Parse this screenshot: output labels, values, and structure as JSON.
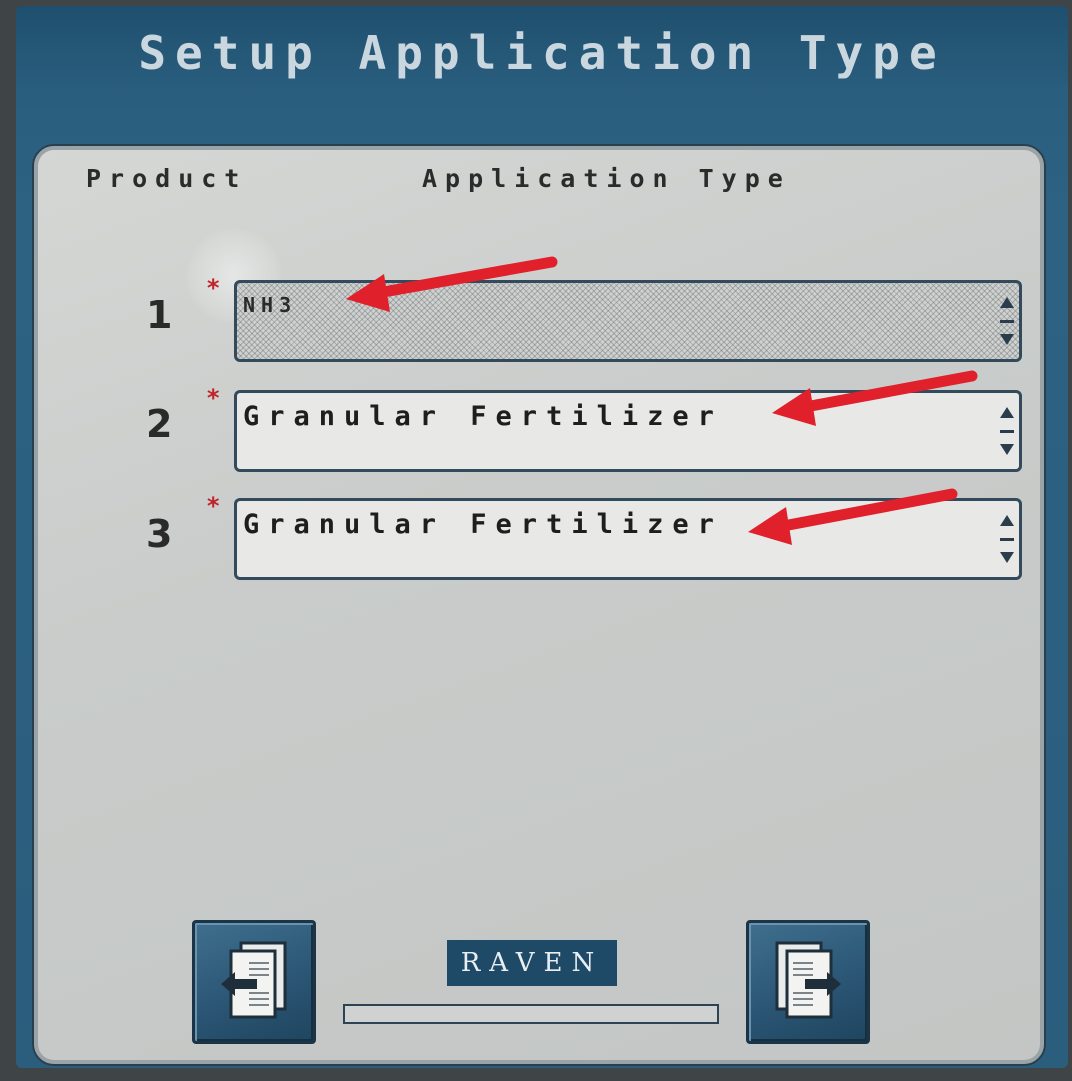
{
  "screen": {
    "title": "Setup Application Type"
  },
  "table": {
    "headers": {
      "product": "Product",
      "application_type": "Application Type"
    },
    "rows": [
      {
        "number": "1",
        "required": "*",
        "value": "NH3",
        "selected": true
      },
      {
        "number": "2",
        "required": "*",
        "value": "Granular Fertilizer",
        "selected": false
      },
      {
        "number": "3",
        "required": "*",
        "value": "Granular Fertilizer",
        "selected": false
      }
    ]
  },
  "footer": {
    "logo": "RAVEN",
    "progress": 0,
    "back_icon": "page-back-icon",
    "next_icon": "page-next-icon"
  },
  "colors": {
    "screen_blue": "#2d6283",
    "panel_grey": "#c9ccca",
    "annotation_red": "#e0202a",
    "required_marker": "#c0242a"
  }
}
